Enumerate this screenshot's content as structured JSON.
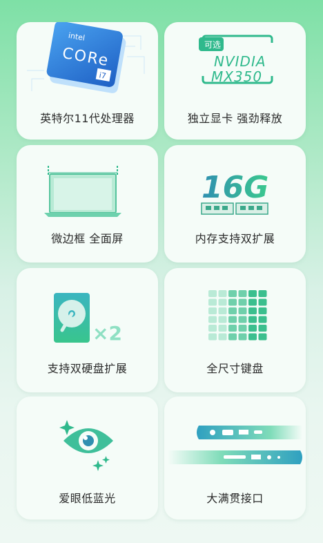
{
  "features": [
    {
      "label": "英特尔11代处理器",
      "chip": {
        "brand": "intel",
        "line": "CORe",
        "tier": "i7"
      }
    },
    {
      "label": "独立显卡 强劲释放",
      "gpu": {
        "badge": "可选",
        "line1": "NVIDIA",
        "line2": "MX350"
      }
    },
    {
      "label": "微边框 全面屏"
    },
    {
      "label": "内存支持双扩展",
      "memory": "16G"
    },
    {
      "label": "支持双硬盘扩展",
      "multiplier": "×2"
    },
    {
      "label": "全尺寸键盘"
    },
    {
      "label": "爱眼低蓝光"
    },
    {
      "label": "大满贯接口"
    }
  ],
  "colors": {
    "accent": "#2fb98c",
    "accent_light": "#8fe0c3",
    "card_bg": "#f5fcf8",
    "text": "#2a2a2a"
  }
}
